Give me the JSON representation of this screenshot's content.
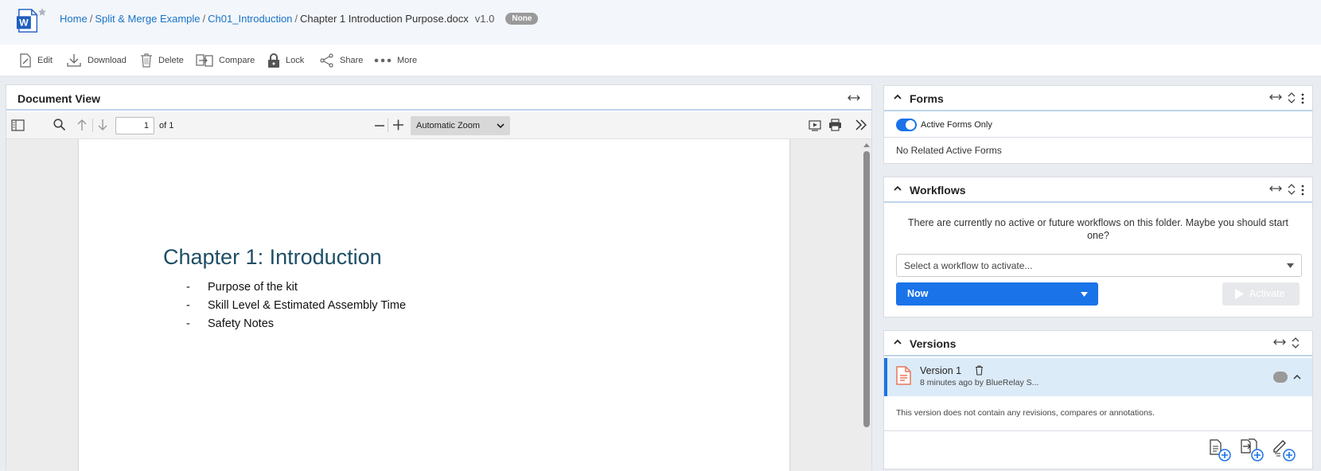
{
  "breadcrumb": {
    "items": [
      "Home",
      "Split & Merge Example",
      "Ch01_Introduction"
    ],
    "separator": "/",
    "current": "Chapter 1 Introduction Purpose.docx",
    "version": "v1.0",
    "badge": "None"
  },
  "toolbar": {
    "edit": "Edit",
    "download": "Download",
    "delete": "Delete",
    "compare": "Compare",
    "lock": "Lock",
    "share": "Share",
    "more": "More"
  },
  "doc_view": {
    "title": "Document View",
    "page_number": "1",
    "page_count": "of 1",
    "zoom": "Automatic Zoom",
    "chapter_title": "Chapter 1: Introduction",
    "bullet_dash": "-",
    "bullets": [
      "Purpose of the kit",
      "Skill Level & Estimated Assembly Time",
      "Safety Notes"
    ]
  },
  "forms": {
    "title": "Forms",
    "toggle_label": "Active Forms Only",
    "toggle_on": true,
    "empty_text": "No Related Active Forms"
  },
  "workflows": {
    "title": "Workflows",
    "message": "There are currently no active or future workflows on this folder. Maybe you should start one?",
    "select_placeholder": "Select a workflow to activate...",
    "timing": "Now",
    "activate_label": "Activate"
  },
  "versions": {
    "title": "Versions",
    "version_name": "Version 1",
    "version_meta": "8 minutes ago by BlueRelay S...",
    "version_note": "This version does not contain any revisions, compares or annotations."
  },
  "colors": {
    "accent": "#1a73e8",
    "link": "#1a73c8",
    "badge": "#9a9a9a",
    "chapter": "#1f4e66",
    "version_icon": "#e8765a",
    "selected_bg": "#dcebf8"
  }
}
